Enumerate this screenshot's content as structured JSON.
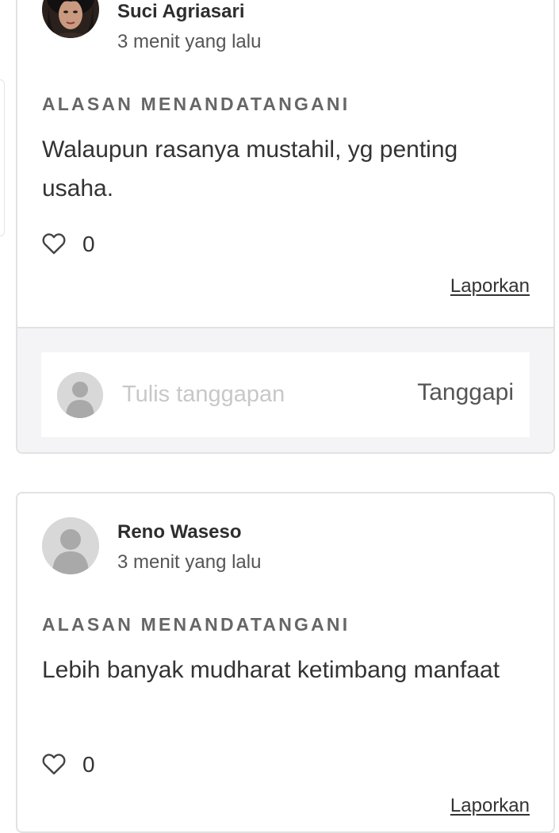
{
  "comments": [
    {
      "author": "Suci Agriasari",
      "time": "3 menit yang lalu",
      "reason_label": "ALASAN MENANDATANGANI",
      "reason": "Walaupun rasanya mustahil, yg penting usaha.",
      "likes": "0",
      "report_label": "Laporkan",
      "avatar": "photo-avatar"
    },
    {
      "author": "Reno Waseso",
      "time": "3 menit yang lalu",
      "reason_label": "ALASAN MENANDATANGANI",
      "reason": "Lebih banyak mudharat ketimbang manfaat",
      "likes": "0",
      "report_label": "Laporkan",
      "avatar": "default-user-avatar"
    }
  ],
  "reply": {
    "placeholder": "Tulis tanggapan",
    "button_label": "Tanggapi"
  },
  "icons": {
    "like": "heart-icon",
    "default_avatar": "user-silhouette-icon"
  },
  "colors": {
    "border": "#e2e2e2",
    "reply_area_bg": "#f4f3f5",
    "text": "#333333",
    "muted": "#666666",
    "placeholder": "#c8c8c8"
  }
}
